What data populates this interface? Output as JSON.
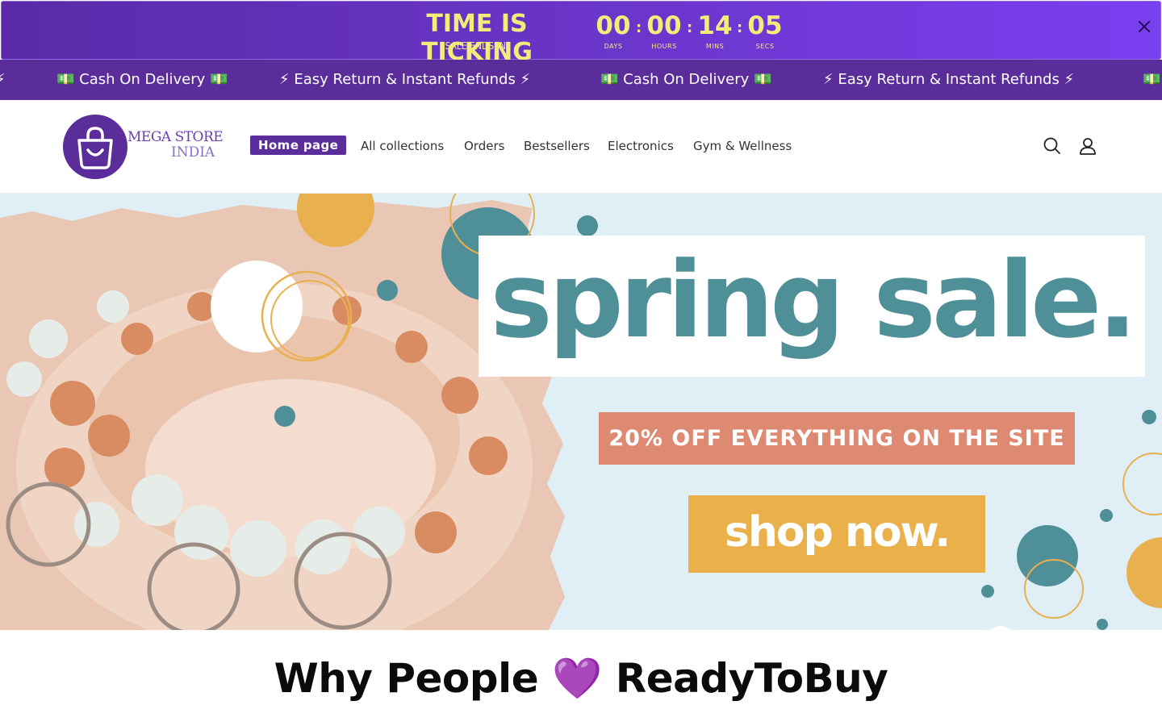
{
  "countdown": {
    "title": "TIME IS TICKING",
    "subtitle": "SALE ENDS IN:",
    "units": [
      {
        "value": "00",
        "label": "DAYS"
      },
      {
        "value": "00",
        "label": "HOURS"
      },
      {
        "value": "14",
        "label": "MINS"
      },
      {
        "value": "05",
        "label": "SECS"
      }
    ],
    "separator": ":",
    "close_icon": "close-icon",
    "colors": {
      "text": "#f3ec7b",
      "bg_start": "#5a2aa8",
      "bg_end": "#7a3ff0"
    }
  },
  "marquee": {
    "items": [
      "💵 Cash On Delivery 💵",
      "⚡ Easy Return & Instant Refunds ⚡",
      "💵 Cash On Delivery 💵",
      "⚡ Easy Return & Instant Refunds ⚡"
    ],
    "background": "#5a2d9a"
  },
  "header": {
    "logo": {
      "line1": "MEGA STORE",
      "line2": "INDIA",
      "icon": "shopping-bag-icon"
    },
    "nav": [
      {
        "label": "Home page",
        "active": true
      },
      {
        "label": "All collections"
      },
      {
        "label": "Orders"
      },
      {
        "label": "Bestsellers"
      },
      {
        "label": "Electronics"
      },
      {
        "label": "Gym & Wellness"
      }
    ],
    "icons": [
      "search-icon",
      "account-icon"
    ],
    "accent": "#5a2d9a"
  },
  "hero": {
    "headline": "spring sale.",
    "offer": "20% OFF EVERYTHING ON THE SITE",
    "cta": "shop now.",
    "colors": {
      "headline": "#4f8f98",
      "offer_bg": "#de8a72",
      "cta_bg": "#eab04a",
      "background": "#e0eef6"
    }
  },
  "section": {
    "heading_prefix": "Why People",
    "heading_heart": "💜",
    "heading_suffix": "ReadyToBuy"
  }
}
